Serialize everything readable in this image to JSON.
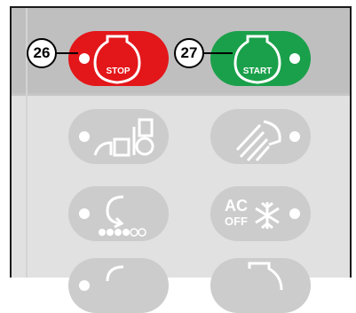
{
  "callouts": {
    "stop": "26",
    "start": "27"
  },
  "buttons": {
    "stop": {
      "label": "STOP",
      "color": "#e3161a"
    },
    "start": {
      "label": "START",
      "color": "#1aa04a"
    },
    "ac": {
      "line1": "AC",
      "line2": "OFF"
    }
  },
  "icons": {
    "stop": "engine-stop-icon",
    "start": "engine-start-icon",
    "harvester": "harvester-icon",
    "work_light": "work-light-icon",
    "rotation_speed": "rotation-speed-icon",
    "ac_off": "snowflake-icon"
  },
  "colors": {
    "panel": "#e1e1e1",
    "band": "#bfbfbf",
    "disabled": "#cccccc"
  }
}
